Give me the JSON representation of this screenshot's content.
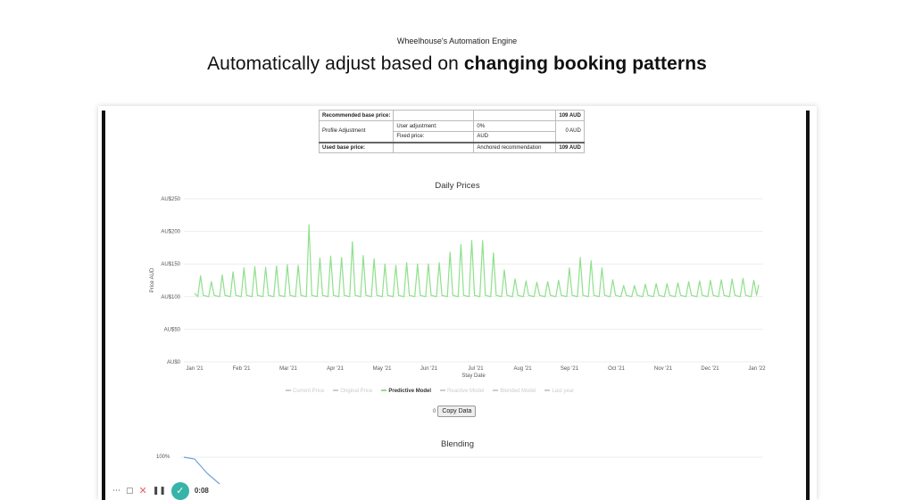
{
  "slide": {
    "kicker": "Wheelhouse's Automation Engine",
    "title_prefix": "Automatically adjust based on ",
    "title_bold": "changing booking patterns"
  },
  "pricing_table": {
    "recommended_label": "Recommended base price:",
    "recommended_value": "109 AUD",
    "profile_label": "Profile Adjustment",
    "user_adj_label": "User adjustment:",
    "user_adj_value": "0%",
    "fixed_price_label": "Fixed price:",
    "fixed_price_value": "AUD",
    "profile_total": "0 AUD",
    "used_label": "Used base price:",
    "used_note": "Anchored recommendation",
    "used_value": "109 AUD"
  },
  "chart_data": {
    "type": "line",
    "title": "Daily Prices",
    "xlabel": "Stay Date",
    "ylabel": "Price AUD",
    "y_ticks": [
      "AU$0",
      "AU$50",
      "AU$100",
      "AU$150",
      "AU$200",
      "AU$250"
    ],
    "ylim": [
      0,
      250
    ],
    "x_ticks": [
      "Jan '21",
      "Feb '21",
      "Mar '21",
      "Apr '21",
      "May '21",
      "Jun '21",
      "Jul '21",
      "Aug '21",
      "Sep '21",
      "Oct '21",
      "Nov '21",
      "Dec '21",
      "Jan '22"
    ],
    "legend_position": "bottom",
    "grid": true,
    "series": [
      {
        "name": "Predictive Model",
        "color": "#8fe08c",
        "weekly_peaks": [
          132,
          123,
          133,
          138,
          144,
          146,
          145,
          147,
          149,
          148,
          210,
          159,
          162,
          160,
          184,
          163,
          158,
          150,
          148,
          152,
          150,
          150,
          152,
          168,
          180,
          186,
          186,
          167,
          141,
          127,
          124,
          122,
          123,
          125,
          144,
          160,
          155,
          144,
          126,
          117,
          117,
          119,
          120,
          120,
          121,
          123,
          124,
          125,
          126,
          127,
          128,
          125
        ],
        "baseline": 100
      }
    ]
  },
  "legend": {
    "items": [
      "Current Price",
      "Original Price",
      "Predictive Model",
      "Reactive Model",
      "Blended Model",
      "Last year"
    ],
    "active": "Predictive Model"
  },
  "copy_button": "Copy Data",
  "copy_prefix": "0",
  "blending": {
    "title": "Blending",
    "axis_label": "100%"
  },
  "recorder": {
    "time": "0:08"
  }
}
